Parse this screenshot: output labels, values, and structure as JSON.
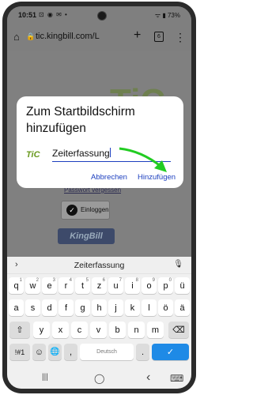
{
  "status_bar": {
    "time": "10:51",
    "notif_icons": "⊡ ◉ ✉ •",
    "right": "ᯤ ▮ 73%"
  },
  "browser": {
    "home_icon": "⌂",
    "lock_icon": "🔒",
    "url": "tic.kingbill.com/L",
    "plus_icon": "+",
    "tab_count": "6",
    "menu_icon": "⋮"
  },
  "page": {
    "background_logo": "TiC",
    "link_text": "Passwort vergessen",
    "login_button": "Einloggen",
    "brand_logo": "KingBill"
  },
  "dialog": {
    "title": "Zum Startbildschirm hinzufügen",
    "app_logo": "TiC",
    "name_value": "Zeiterfassung",
    "cancel_label": "Abbrechen",
    "add_label": "Hinzufügen"
  },
  "keyboard": {
    "suggestion": "Zeiterfassung",
    "chevron": "›",
    "mic_icon": "🎙",
    "row1": [
      {
        "key": "q",
        "num": "1"
      },
      {
        "key": "w",
        "num": "2"
      },
      {
        "key": "e",
        "num": "3"
      },
      {
        "key": "r",
        "num": "4"
      },
      {
        "key": "t",
        "num": "5"
      },
      {
        "key": "z",
        "num": "6"
      },
      {
        "key": "u",
        "num": "7"
      },
      {
        "key": "i",
        "num": "8"
      },
      {
        "key": "o",
        "num": "9"
      },
      {
        "key": "p",
        "num": "0"
      },
      {
        "key": "ü",
        "num": ""
      }
    ],
    "row2": [
      "a",
      "s",
      "d",
      "f",
      "g",
      "h",
      "j",
      "k",
      "l",
      "ö",
      "ä"
    ],
    "row3": [
      "y",
      "x",
      "c",
      "v",
      "b",
      "n",
      "m"
    ],
    "shift_icon": "⇧",
    "backspace_icon": "⌫",
    "sym_label": "!#1",
    "emoji_icon": "☺",
    "globe_icon": "🌐",
    "comma": ",",
    "space_label": "Deutsch",
    "period": ".",
    "done_icon": "✓"
  },
  "nav_bar": {
    "recents_icon": "|||",
    "home_icon": "◯",
    "back_icon": "‹",
    "keyboard_icon": "⌨"
  },
  "colors": {
    "accent": "#1c3fbf",
    "done_key": "#1e8ae6",
    "arrow": "#22cc22",
    "scrim": "#808080"
  }
}
